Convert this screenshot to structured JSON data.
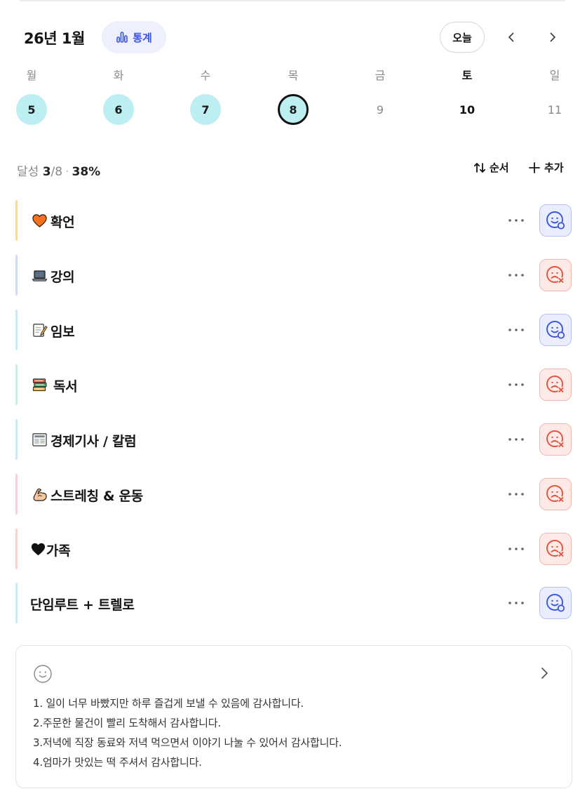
{
  "header": {
    "month_title": "26년 1월",
    "stats_label": "통계",
    "today_label": "오늘",
    "accent_color": "#3a55e0"
  },
  "week": {
    "days": [
      {
        "name": "월",
        "date": "5",
        "state": "done"
      },
      {
        "name": "화",
        "date": "6",
        "state": "done"
      },
      {
        "name": "수",
        "date": "7",
        "state": "done"
      },
      {
        "name": "목",
        "date": "8",
        "state": "today"
      },
      {
        "name": "금",
        "date": "9",
        "state": "future"
      },
      {
        "name": "토",
        "date": "10",
        "state": "future-bold"
      },
      {
        "name": "일",
        "date": "11",
        "state": "future"
      }
    ]
  },
  "summary": {
    "label": "달성",
    "done": "3",
    "total": "/8",
    "sep": "·",
    "percent": "38%",
    "order_label": "순서",
    "add_label": "추가"
  },
  "habits": [
    {
      "icon": "heart-orange-icon",
      "name": "확언",
      "status": "success",
      "color": "#f7d9a8"
    },
    {
      "icon": "laptop-icon",
      "name": "강의",
      "status": "fail",
      "color": "#d3dbf1"
    },
    {
      "icon": "memo-icon",
      "name": "임보",
      "status": "success",
      "color": "#cfe9f4"
    },
    {
      "icon": "books-icon",
      "name": "독서",
      "status": "fail",
      "color": "#cdeedd"
    },
    {
      "icon": "newspaper-icon",
      "name": "경제기사 / 칼럼",
      "status": "fail",
      "color": "#cfe9f4"
    },
    {
      "icon": "flexed-biceps-icon",
      "name": "스트레칭 & 운동",
      "status": "fail",
      "color": "#f6cfe0"
    },
    {
      "icon": "black-heart-icon",
      "name": "가족",
      "status": "fail",
      "color": "#f8d3d3"
    },
    {
      "icon": "",
      "name": "단임루트 + 트렐로",
      "status": "success",
      "color": "#cfe9f4"
    }
  ],
  "journal": {
    "lines": [
      "1. 일이 너무 바빴지만 하루 즐겁게 보낼 수 있음에 감사합니다.",
      "2.주문한 물건이 빨리 도착해서 감사합니다.",
      "3.저녁에 직장 동료와 저녁 먹으면서 이야기 나눌 수 있어서 감사합니다.",
      "4.엄마가 맛있는 떡 주셔서 감사합니다."
    ]
  }
}
